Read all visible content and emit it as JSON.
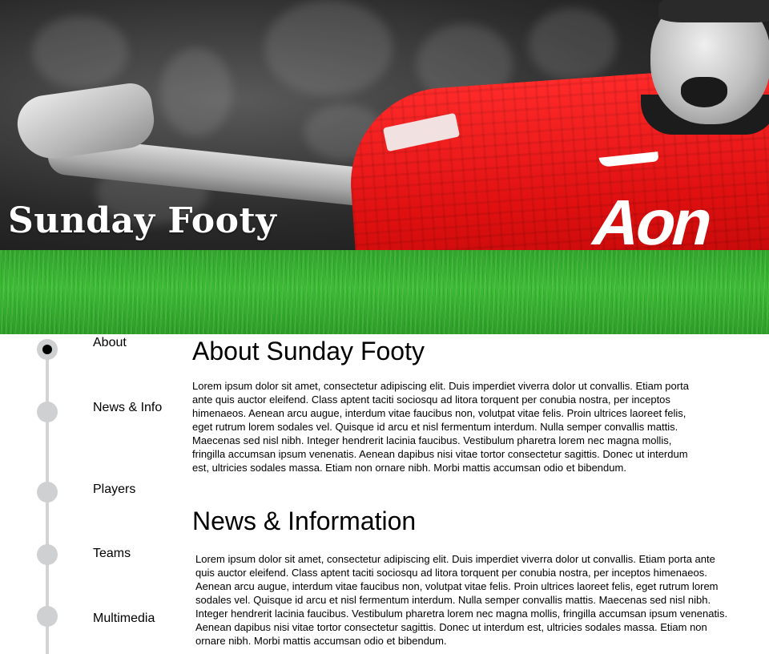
{
  "site": {
    "title": "Sunday Footy",
    "banner_sponsor": "Aon"
  },
  "nav": {
    "items": [
      {
        "label": "About",
        "active": true
      },
      {
        "label": "News & Info",
        "active": false
      },
      {
        "label": "Players",
        "active": false
      },
      {
        "label": "Teams",
        "active": false
      },
      {
        "label": "Multimedia",
        "active": false
      }
    ]
  },
  "sections": [
    {
      "title": "About Sunday Footy",
      "body": "Lorem ipsum dolor sit amet, consectetur adipiscing elit. Duis imperdiet viverra dolor ut convallis. Etiam porta ante quis auctor eleifend. Class aptent taciti sociosqu ad litora torquent per conubia nostra, per inceptos himenaeos. Aenean arcu augue, interdum vitae faucibus non, volutpat vitae felis. Proin ultrices laoreet felis, eget rutrum lorem sodales vel. Quisque id arcu et nisl fermentum interdum. Nulla semper convallis mattis. Maecenas sed nisl nibh. Integer hendrerit lacinia faucibus. Vestibulum pharetra lorem nec magna mollis, fringilla accumsan ipsum venenatis. Aenean dapibus nisi vitae tortor consectetur sagittis. Donec ut interdum est, ultricies sodales massa. Etiam non ornare nibh. Morbi mattis accumsan odio et bibendum."
    },
    {
      "title": "News & Information",
      "body": "Lorem ipsum dolor sit amet, consectetur adipiscing elit. Duis imperdiet viverra dolor ut convallis. Etiam porta ante quis auctor eleifend. Class aptent taciti sociosqu ad litora torquent per conubia nostra, per inceptos himenaeos. Aenean arcu augue, interdum vitae faucibus non, volutpat vitae felis. Proin ultrices laoreet felis, eget rutrum lorem sodales vel. Quisque id arcu et nisl fermentum interdum. Nulla semper convallis mattis. Maecenas sed nisl nibh. Integer hendrerit lacinia faucibus. Vestibulum pharetra lorem nec magna mollis, fringilla accumsan ipsum venenatis. Aenean dapibus nisi vitae tortor consectetur sagittis. Donec ut interdum est, ultricies sodales massa. Etiam non ornare nibh. Morbi mattis accumsan odio et bibendum."
    }
  ],
  "colors": {
    "timeline": "#d3d3d3",
    "nav_dot": "#cfd0d1",
    "nav_dot_active": "#000000",
    "grass": "#3cbb34",
    "shirt_red": "#e01010"
  }
}
